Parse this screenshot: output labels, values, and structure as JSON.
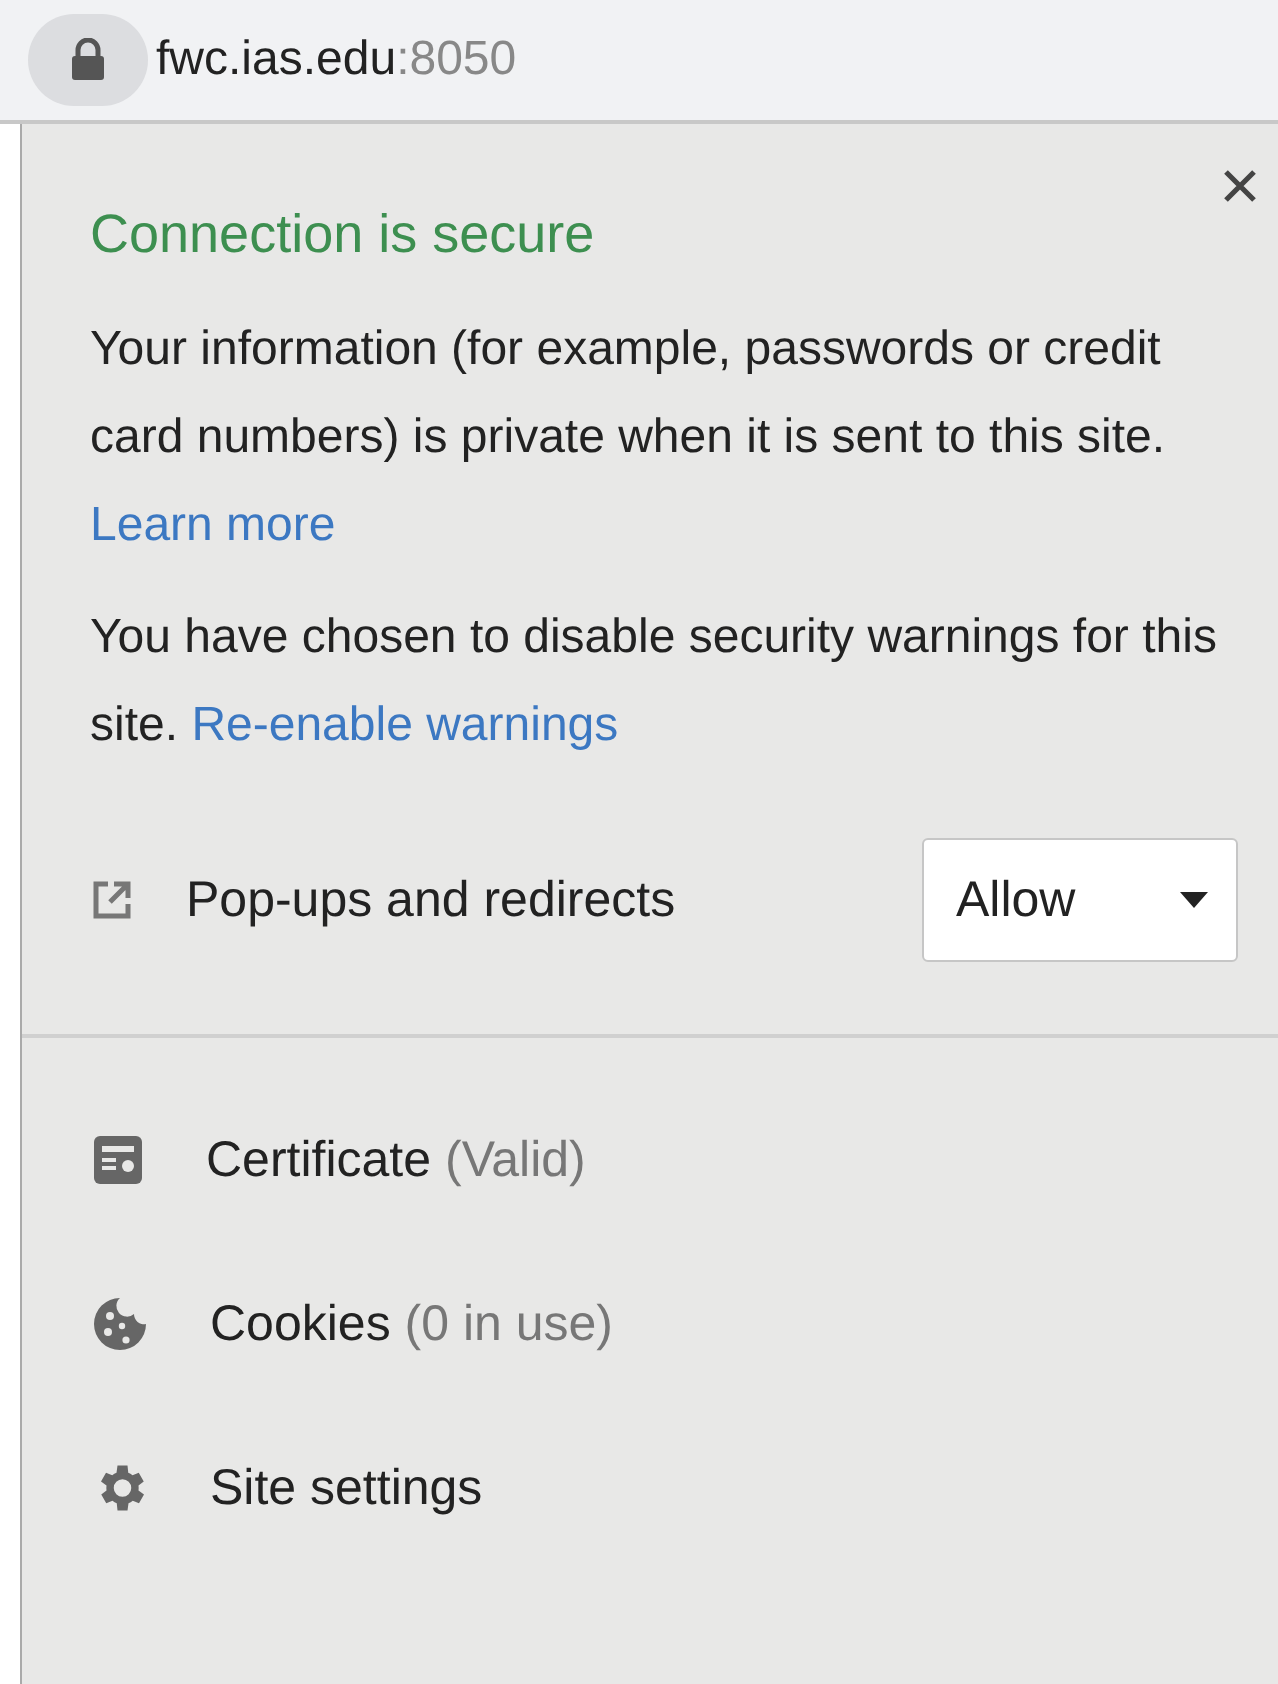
{
  "address_bar": {
    "host": "fwc.ias.edu",
    "port": ":8050"
  },
  "popup": {
    "title": "Connection is secure",
    "paragraphs": [
      {
        "text": "Your information (for example, passwords or credit card numbers) is private when it is sent to this site.",
        "link": "Learn more"
      },
      {
        "text": "You have chosen to disable security warnings for this site.",
        "link": "Re-enable warnings"
      }
    ],
    "permission": {
      "label": "Pop-ups and redirects",
      "value": "Allow"
    },
    "items": [
      {
        "kind": "certificate",
        "label": "Certificate",
        "detail": "(Valid)"
      },
      {
        "kind": "cookies",
        "label": "Cookies",
        "detail": "(0 in use)"
      },
      {
        "kind": "settings",
        "label": "Site settings"
      }
    ]
  }
}
